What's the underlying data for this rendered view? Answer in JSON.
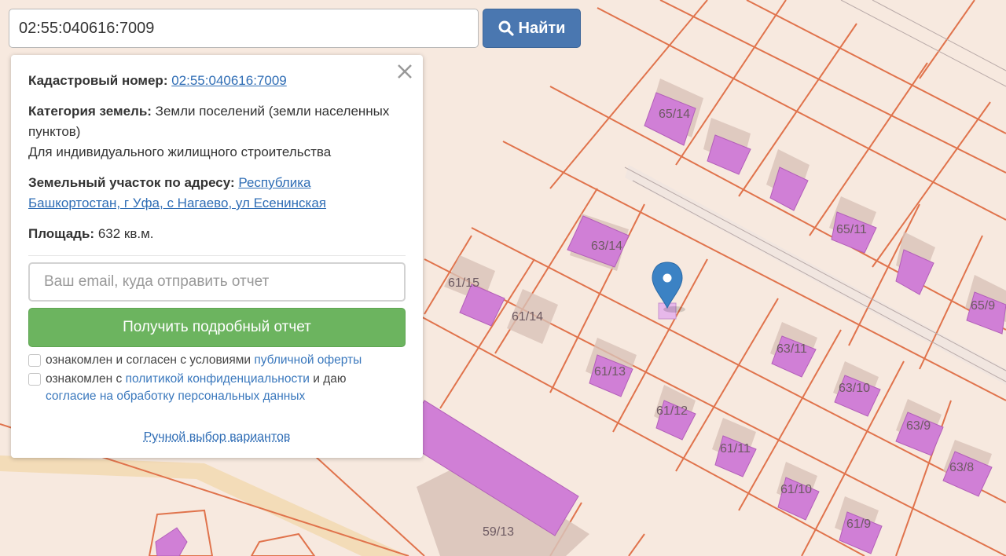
{
  "search": {
    "value": "02:55:040616:7009",
    "button_label": "Найти"
  },
  "popup": {
    "cadastral_label": "Кадастровый номер:",
    "cadastral_value": "02:55:040616:7009",
    "category_label": "Категория земель:",
    "category_value": "Земли поселений (земли населенных пунктов)",
    "permitted_use": "Для индивидуального жилищного строительства",
    "address_label": "Земельный участок по адресу:",
    "address_value": "Республика Башкортостан, г Уфа, с Нагаево, ул Есенинская",
    "area_label": "Площадь:",
    "area_value": "632 кв.м.",
    "email_placeholder": "Ваш email, куда отправить отчет",
    "report_button": "Получить подробный отчет",
    "consent1_text": "ознакомлен и согласен с условиями ",
    "consent1_link": "публичной оферты",
    "consent2_text": "ознакомлен с ",
    "consent2_link": "политикой конфиденциальности",
    "consent2_mid": " и даю",
    "consent2_link2": "согласие на обработку персональных данных",
    "manual_link": "Ручной выбор вариантов"
  },
  "map": {
    "parcel_labels": [
      "65/14",
      "63/14",
      "61/15",
      "61/14",
      "61/13",
      "61/12",
      "61/11",
      "61/10",
      "61/9",
      "65/11",
      "65/9",
      "63/11",
      "63/10",
      "63/9",
      "63/8",
      "59/13"
    ],
    "marker_icon": "location-pin-icon",
    "colors": {
      "background": "#f7e9df",
      "parcel_border": "#e0734c",
      "building": "#d07fd6",
      "marker": "#3b82c4"
    }
  }
}
